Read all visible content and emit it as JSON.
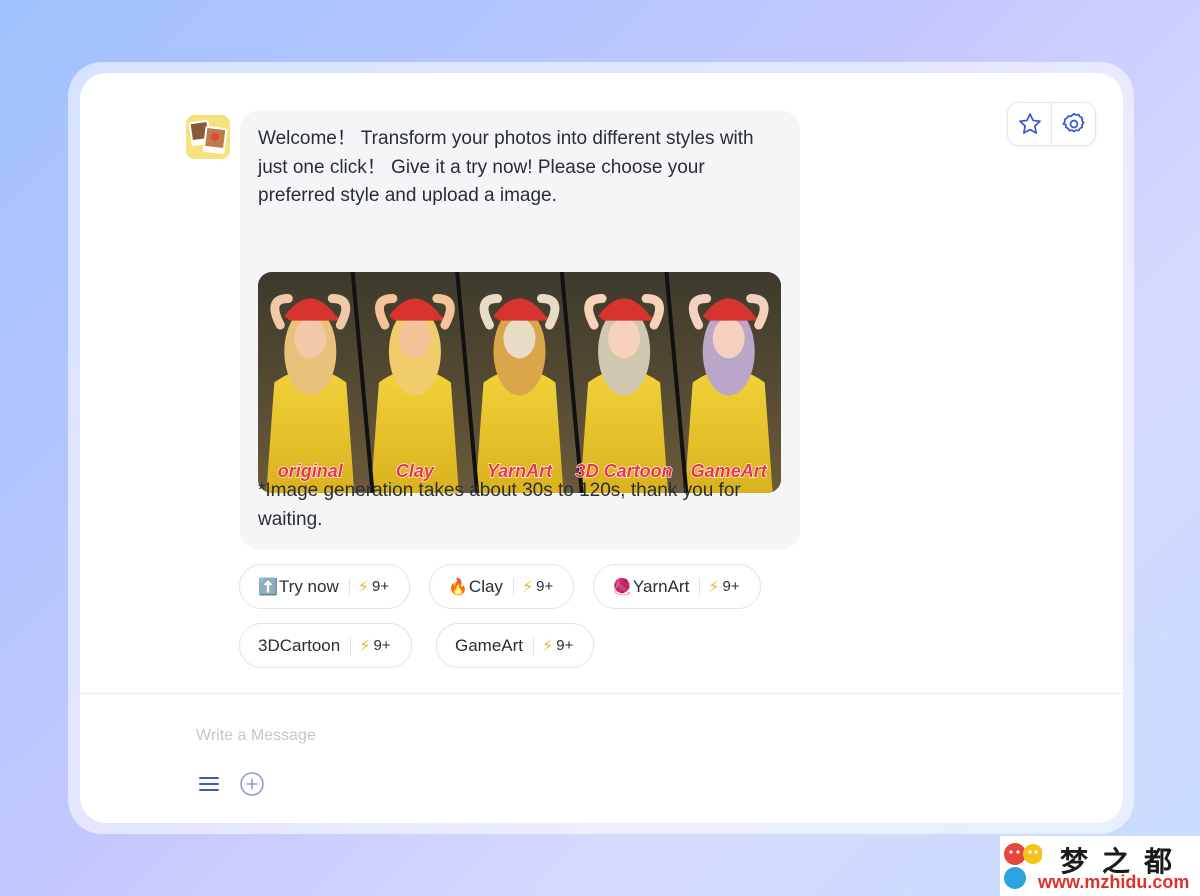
{
  "actions": {
    "favorite_icon": "star-icon",
    "settings_icon": "gear-icon",
    "accent": "#3b57d4"
  },
  "bot": {
    "avatar_icon": "photo-collage-avatar"
  },
  "message": {
    "text": "Welcome！ Transform your photos into different styles with just one click！ Give it a try now! Please choose your preferred style and upload a image.",
    "note": "*Image generation takes about 30s to 120s, thank you for waiting.",
    "preview_labels": [
      "original",
      "Clay",
      "YarnArt",
      "3D Cartoon",
      "GameArt"
    ]
  },
  "chips": [
    {
      "emoji": "⬆️",
      "label": "Try now",
      "count": "9+"
    },
    {
      "emoji": "🔥",
      "label": "Clay",
      "count": "9+"
    },
    {
      "emoji": "🧶",
      "label": "YarnArt",
      "count": "9+"
    },
    {
      "emoji": "",
      "label": "3DCartoon",
      "count": "9+"
    },
    {
      "emoji": "",
      "label": "GameArt",
      "count": "9+"
    }
  ],
  "composer": {
    "placeholder": "Write a Message",
    "menu_icon": "menu-icon",
    "add_icon": "plus-circle-icon"
  },
  "watermark": {
    "title": "梦之都",
    "url": "www.mzhidu.com"
  }
}
